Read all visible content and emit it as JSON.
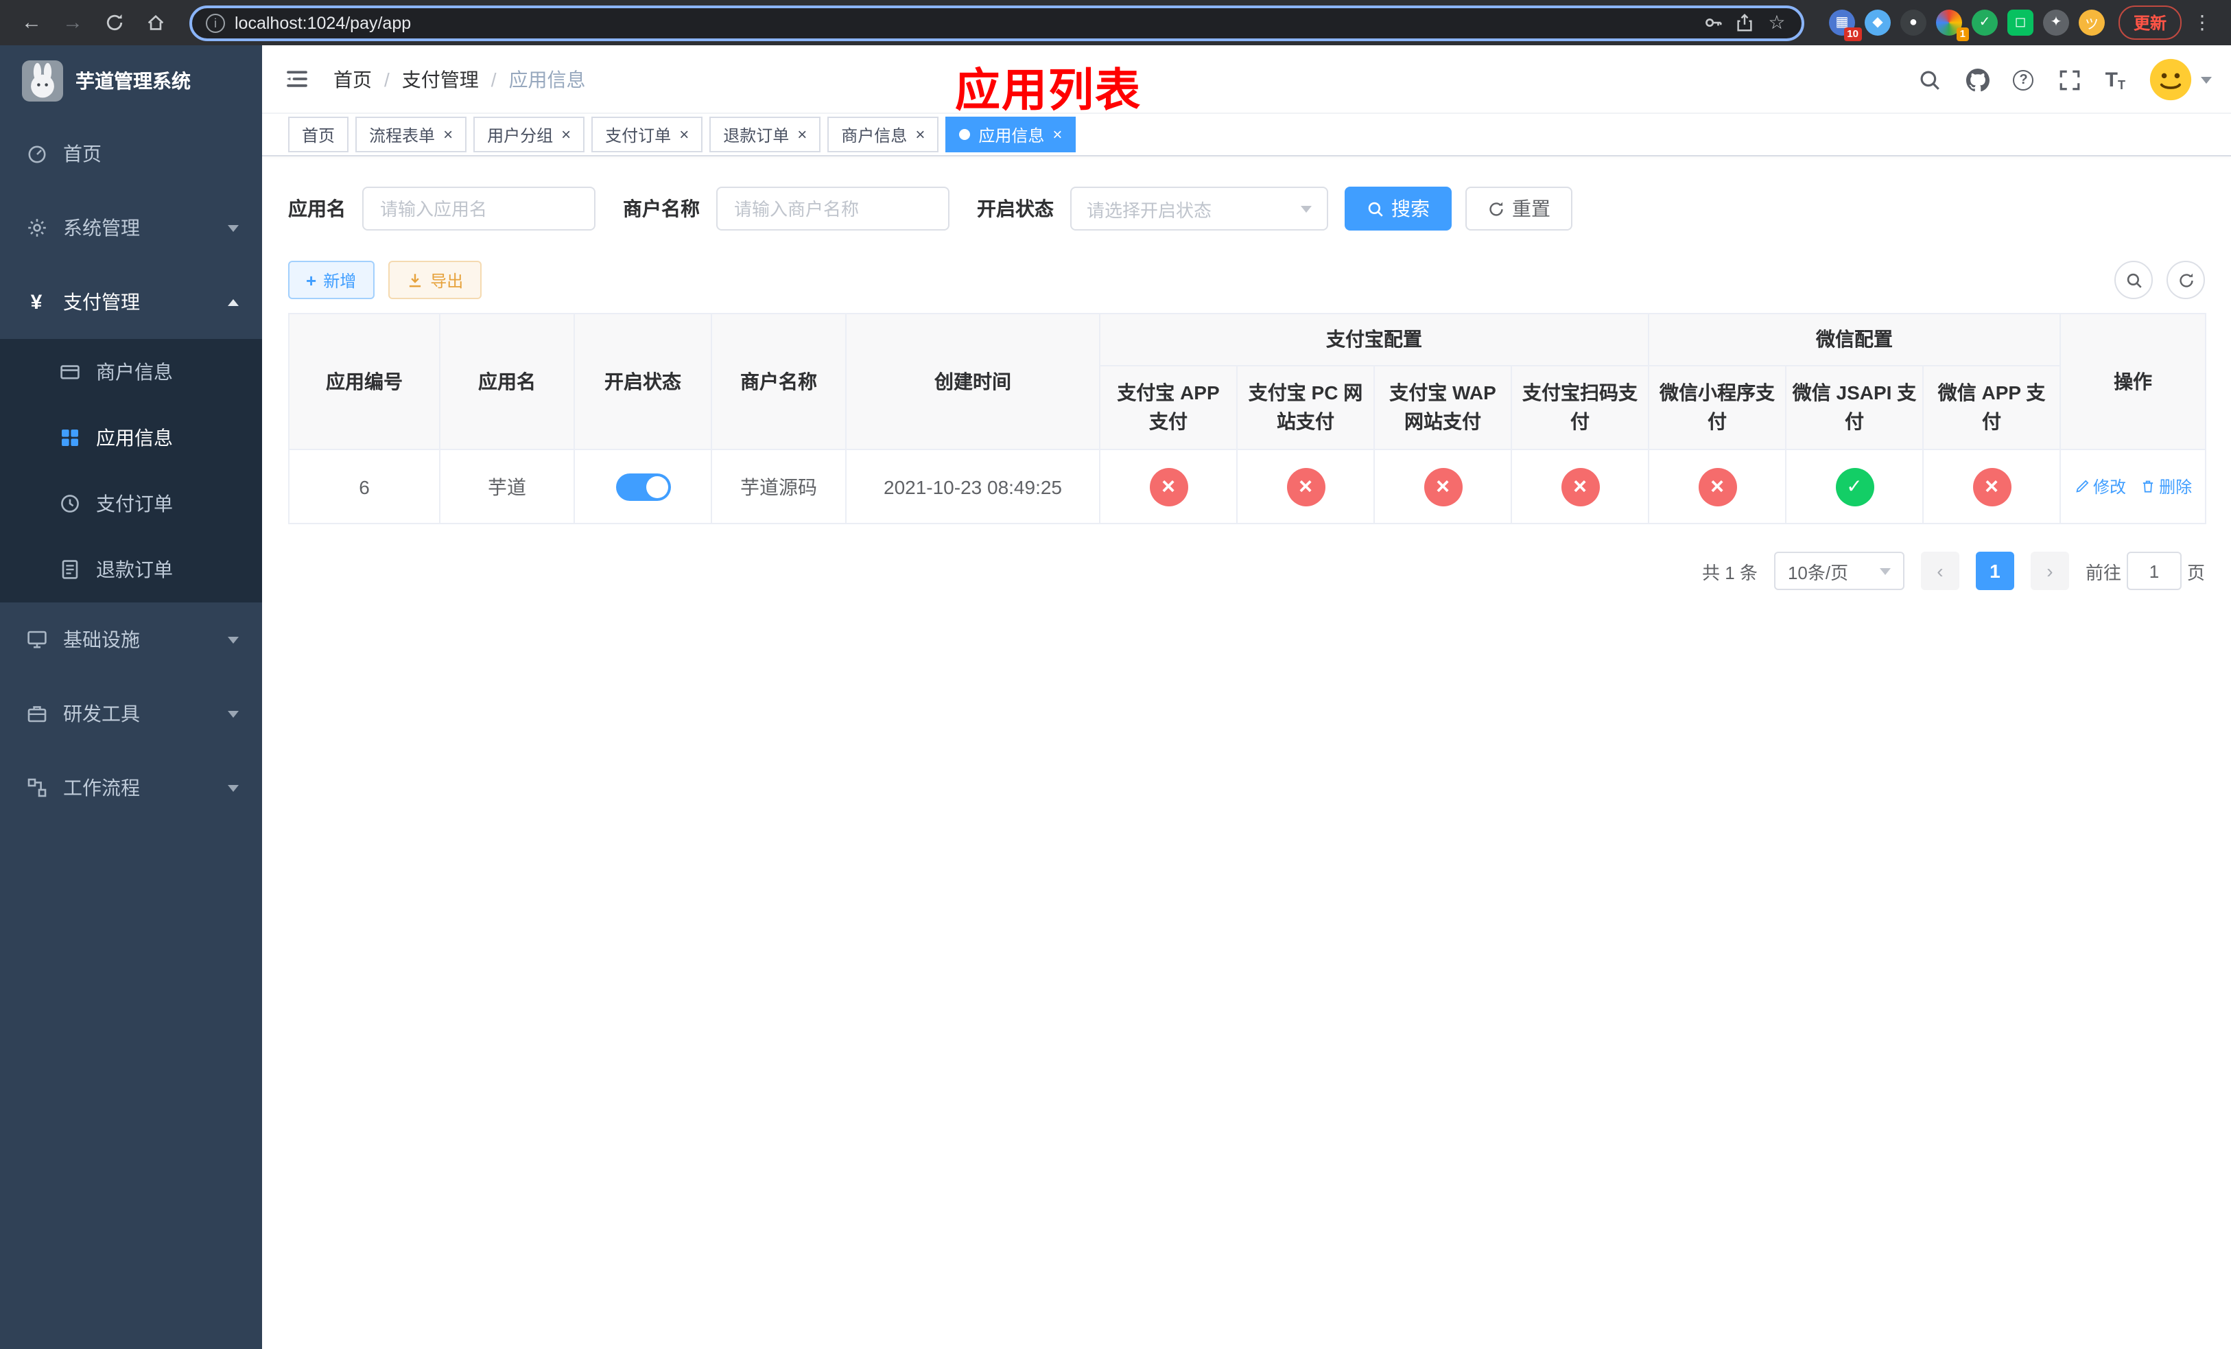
{
  "colors": {
    "accent": "#409eff",
    "success": "#13ce66",
    "danger": "#f56c6c",
    "warning": "#e6a23c",
    "sidebar_bg": "#304156",
    "submenu_bg": "#1f2d3d",
    "overlay_title_red": "#ff0000"
  },
  "browser": {
    "url": "localhost:1024/pay/app",
    "update_label": "更新",
    "extension_badges": [
      "10",
      "1"
    ]
  },
  "sidebar": {
    "title": "芋道管理系统",
    "items": [
      {
        "label": "首页"
      },
      {
        "label": "系统管理"
      },
      {
        "label": "支付管理"
      },
      {
        "label": "商户信息"
      },
      {
        "label": "应用信息"
      },
      {
        "label": "支付订单"
      },
      {
        "label": "退款订单"
      },
      {
        "label": "基础设施"
      },
      {
        "label": "研发工具"
      },
      {
        "label": "工作流程"
      }
    ]
  },
  "header": {
    "breadcrumb": [
      "首页",
      "支付管理",
      "应用信息"
    ],
    "separator": "/",
    "title_overlay": "应用列表"
  },
  "tabs": [
    {
      "label": "首页"
    },
    {
      "label": "流程表单"
    },
    {
      "label": "用户分组"
    },
    {
      "label": "支付订单"
    },
    {
      "label": "退款订单"
    },
    {
      "label": "商户信息"
    },
    {
      "label": "应用信息"
    }
  ],
  "filters": {
    "app_name_label": "应用名",
    "app_name_placeholder": "请输入应用名",
    "merchant_label": "商户名称",
    "merchant_placeholder": "请输入商户名称",
    "status_label": "开启状态",
    "status_placeholder": "请选择开启状态",
    "search_label": "搜索",
    "reset_label": "重置"
  },
  "toolbar": {
    "add_label": "新增",
    "export_label": "导出"
  },
  "table": {
    "group_headers": {
      "alipay": "支付宝配置",
      "wechat": "微信配置"
    },
    "columns": [
      "应用编号",
      "应用名",
      "开启状态",
      "商户名称",
      "创建时间",
      "支付宝 APP 支付",
      "支付宝 PC 网站支付",
      "支付宝 WAP 网站支付",
      "支付宝扫码支付",
      "微信小程序支付",
      "微信 JSAPI 支付",
      "微信 APP 支付",
      "操作"
    ],
    "rows": [
      {
        "id": "6",
        "name": "芋道",
        "enabled": true,
        "merchant": "芋道源码",
        "created": "2021-10-23 08:49:25",
        "configs": [
          "cross",
          "cross",
          "cross",
          "cross",
          "cross",
          "check",
          "cross"
        ],
        "edit_label": "修改",
        "delete_label": "删除"
      }
    ]
  },
  "pagination": {
    "total": "共 1 条",
    "page_size": "10条/页",
    "current_page": "1",
    "goto_label": "前往",
    "goto_value": "1",
    "page_unit": "页"
  }
}
